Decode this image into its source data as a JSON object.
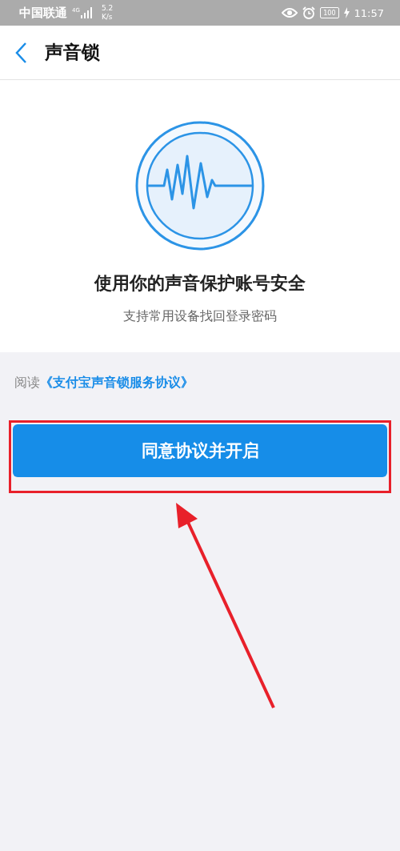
{
  "status_bar": {
    "carrier": "中国联通",
    "network": "4G",
    "speed_value": "5.2",
    "speed_unit": "K/s",
    "battery": "100",
    "time": "11:57"
  },
  "header": {
    "title": "声音锁"
  },
  "hero": {
    "headline": "使用你的声音保护账号安全",
    "subtitle": "支持常用设备找回登录密码"
  },
  "agreement": {
    "prefix": "阅读",
    "link": "《支付宝声音锁服务协议》"
  },
  "primary_button": {
    "label": "同意协议并开启"
  }
}
